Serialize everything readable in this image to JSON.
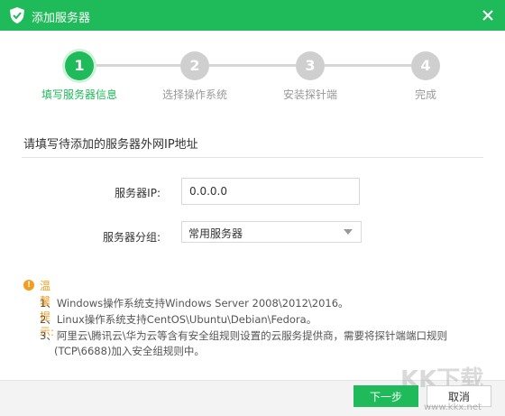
{
  "window": {
    "title": "添加服务器"
  },
  "steps": [
    {
      "num": "1",
      "label": "填写服务器信息",
      "active": true
    },
    {
      "num": "2",
      "label": "选择操作系统",
      "active": false
    },
    {
      "num": "3",
      "label": "安装探针端",
      "active": false
    },
    {
      "num": "4",
      "label": "完成",
      "active": false
    }
  ],
  "section": {
    "title": "请填写待添加的服务器外网IP地址"
  },
  "form": {
    "ip_label": "服务器IP:",
    "ip_value": "0.0.0.0",
    "group_label": "服务器分组:",
    "group_value": "常用服务器"
  },
  "tips": {
    "title": "温馨提示:",
    "items": [
      "1、Windows操作系统支持Windows Server 2008\\2012\\2016。",
      "2、Linux操作系统支持CentOS\\Ubuntu\\Debian\\Fedora。",
      "3、阿里云\\腾讯云\\华为云等含有安全组规则设置的云服务提供商，需要将探针端端口规则",
      "(TCP\\6688)加入安全组规则中。"
    ]
  },
  "buttons": {
    "next": "下一步",
    "cancel": "取消"
  },
  "watermark": {
    "text": "KK下载",
    "url": "www.kkx.net"
  },
  "colors": {
    "accent": "#1fba59",
    "warning": "#f39c1f",
    "inactive": "#cfcfcf"
  },
  "icons": {
    "logo": "shield-check-icon",
    "close": "close-icon",
    "dropdown": "chevron-down-icon",
    "warning": "exclamation-circle-icon"
  }
}
